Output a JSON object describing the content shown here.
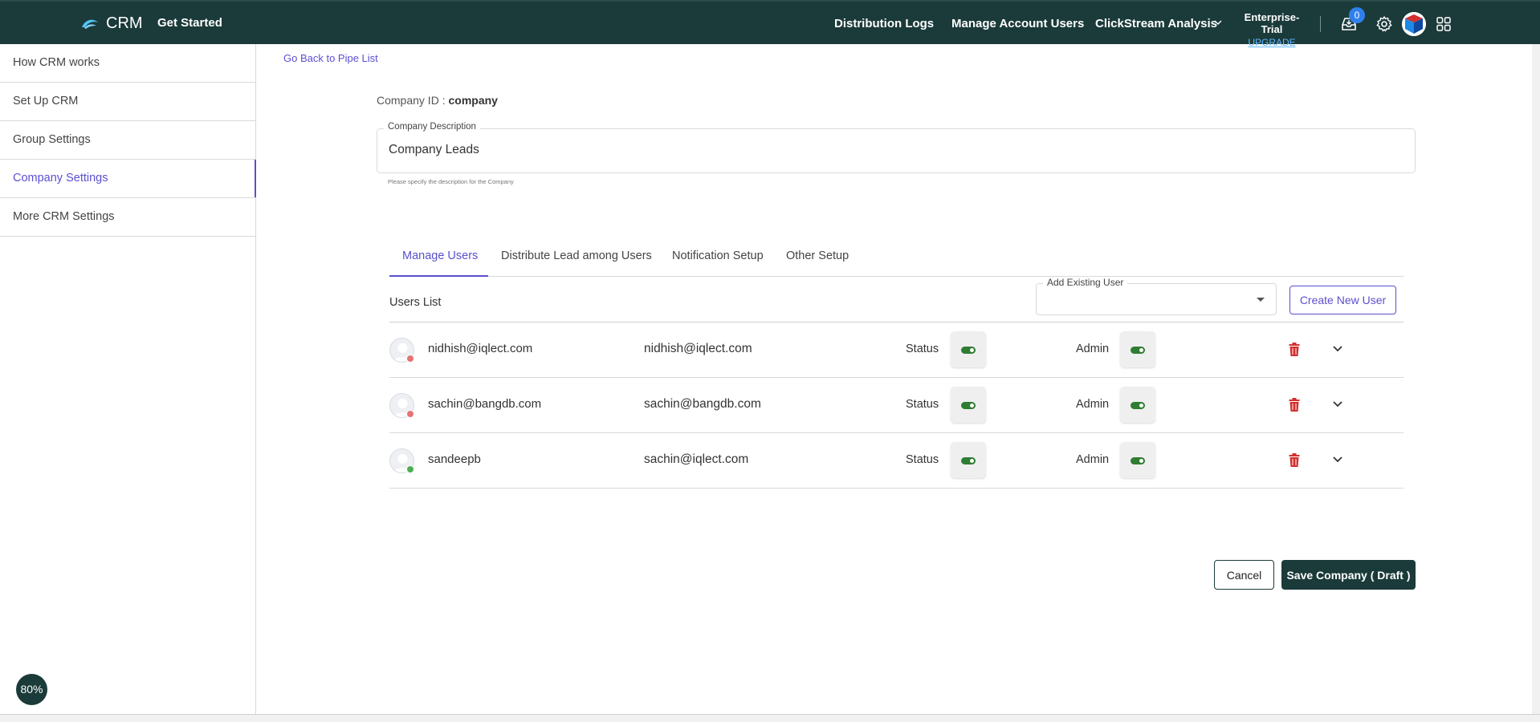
{
  "header": {
    "logo_text": "CRM",
    "get_started": "Get Started",
    "nav": [
      "Distribution Logs",
      "Manage Account Users",
      "ClickStream Analysis"
    ],
    "plan": "Enterprise-Trial",
    "upgrade": "UPGRADE",
    "notification_count": "0",
    "icons": [
      "inbox-icon",
      "gear-icon",
      "avatar",
      "apps-grid-icon"
    ]
  },
  "sidebar": {
    "items": [
      {
        "label": "How CRM works"
      },
      {
        "label": "Set Up CRM"
      },
      {
        "label": "Group Settings"
      },
      {
        "label": "Company Settings"
      },
      {
        "label": "More CRM Settings"
      }
    ],
    "active_index": 3,
    "zoom": "80%"
  },
  "main": {
    "back_link": "Go Back to Pipe List",
    "company_id_label": "Company ID :",
    "company_id_value": "company",
    "description": {
      "label": "Company Description",
      "value": "Company Leads",
      "help": "Please specify the description for the Company"
    },
    "tabs": [
      {
        "label": "Manage Users"
      },
      {
        "label": "Distribute Lead among Users"
      },
      {
        "label": "Notification Setup"
      },
      {
        "label": "Other Setup"
      }
    ],
    "active_tab": 0,
    "users_list_label": "Users List",
    "add_existing_user_label": "Add Existing User",
    "create_new_user": "Create New User",
    "status_label": "Status",
    "admin_label": "Admin",
    "users": [
      {
        "name": "nidhish@iqlect.com",
        "email": "nidhish@iqlect.com",
        "online": false,
        "status": true,
        "admin": true
      },
      {
        "name": "sachin@bangdb.com",
        "email": "sachin@bangdb.com",
        "online": false,
        "status": true,
        "admin": true
      },
      {
        "name": "sandeepb",
        "email": "sachin@iqlect.com",
        "online": true,
        "status": true,
        "admin": true
      }
    ],
    "cancel": "Cancel",
    "save": "Save Company ( Draft )"
  },
  "colors": {
    "header_bg": "#1b3a3a",
    "accent": "#5a4fcf",
    "toggle_on": "#2e7d32",
    "offline_dot": "#e57373",
    "online_dot": "#4caf50",
    "danger": "#d32f2f"
  }
}
